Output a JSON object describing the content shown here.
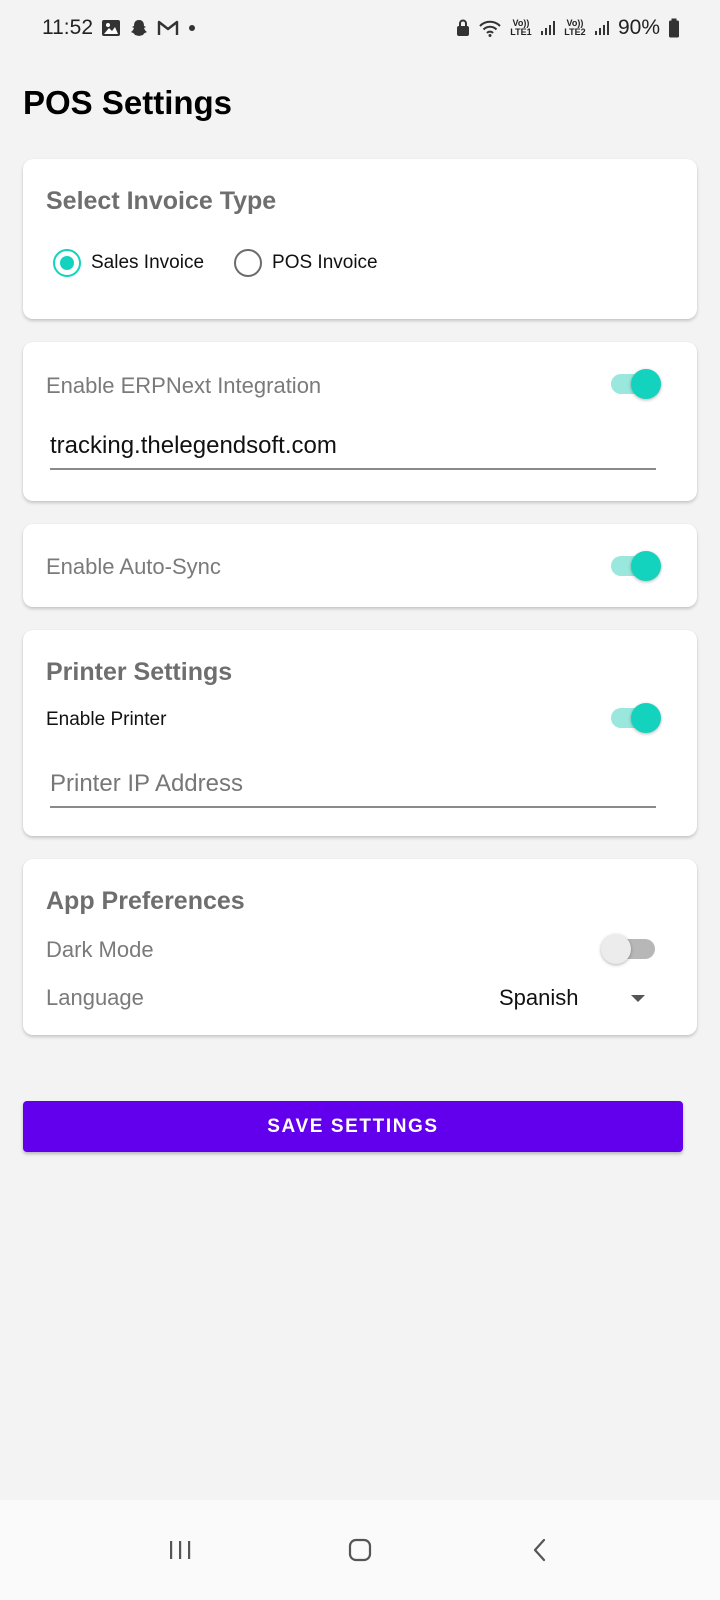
{
  "status_bar": {
    "time": "11:52",
    "battery": "90%",
    "sim1_label": "Vo)) LTE1",
    "sim2_label": "Vo)) LTE2",
    "icons": [
      "gallery-icon",
      "snapchat-icon",
      "gmail-icon",
      "dot-icon",
      "lock-icon",
      "wifi-icon",
      "signal-icon",
      "battery-icon"
    ]
  },
  "page": {
    "title": "POS Settings"
  },
  "invoice_card": {
    "heading": "Select Invoice Type",
    "options": [
      {
        "label": "Sales Invoice",
        "checked": true
      },
      {
        "label": "POS Invoice",
        "checked": false
      }
    ]
  },
  "erp_card": {
    "label": "Enable ERPNext Integration",
    "enabled": true,
    "url_value": "tracking.thelegendsoft.com"
  },
  "sync_card": {
    "label": "Enable Auto-Sync",
    "enabled": true
  },
  "printer_card": {
    "heading": "Printer Settings",
    "enable_label": "Enable Printer",
    "enabled": true,
    "ip_placeholder": "Printer IP Address",
    "ip_value": ""
  },
  "prefs_card": {
    "heading": "App Preferences",
    "dark_mode_label": "Dark Mode",
    "dark_mode_enabled": false,
    "language_label": "Language",
    "language_value": "Spanish"
  },
  "actions": {
    "save_label": "SAVE SETTINGS"
  },
  "colors": {
    "accent": "#13d3be",
    "primary_button": "#6200ee",
    "background": "#f3f3f4"
  },
  "nav_bar": {
    "icons": [
      "recents-icon",
      "home-icon",
      "back-icon"
    ]
  }
}
